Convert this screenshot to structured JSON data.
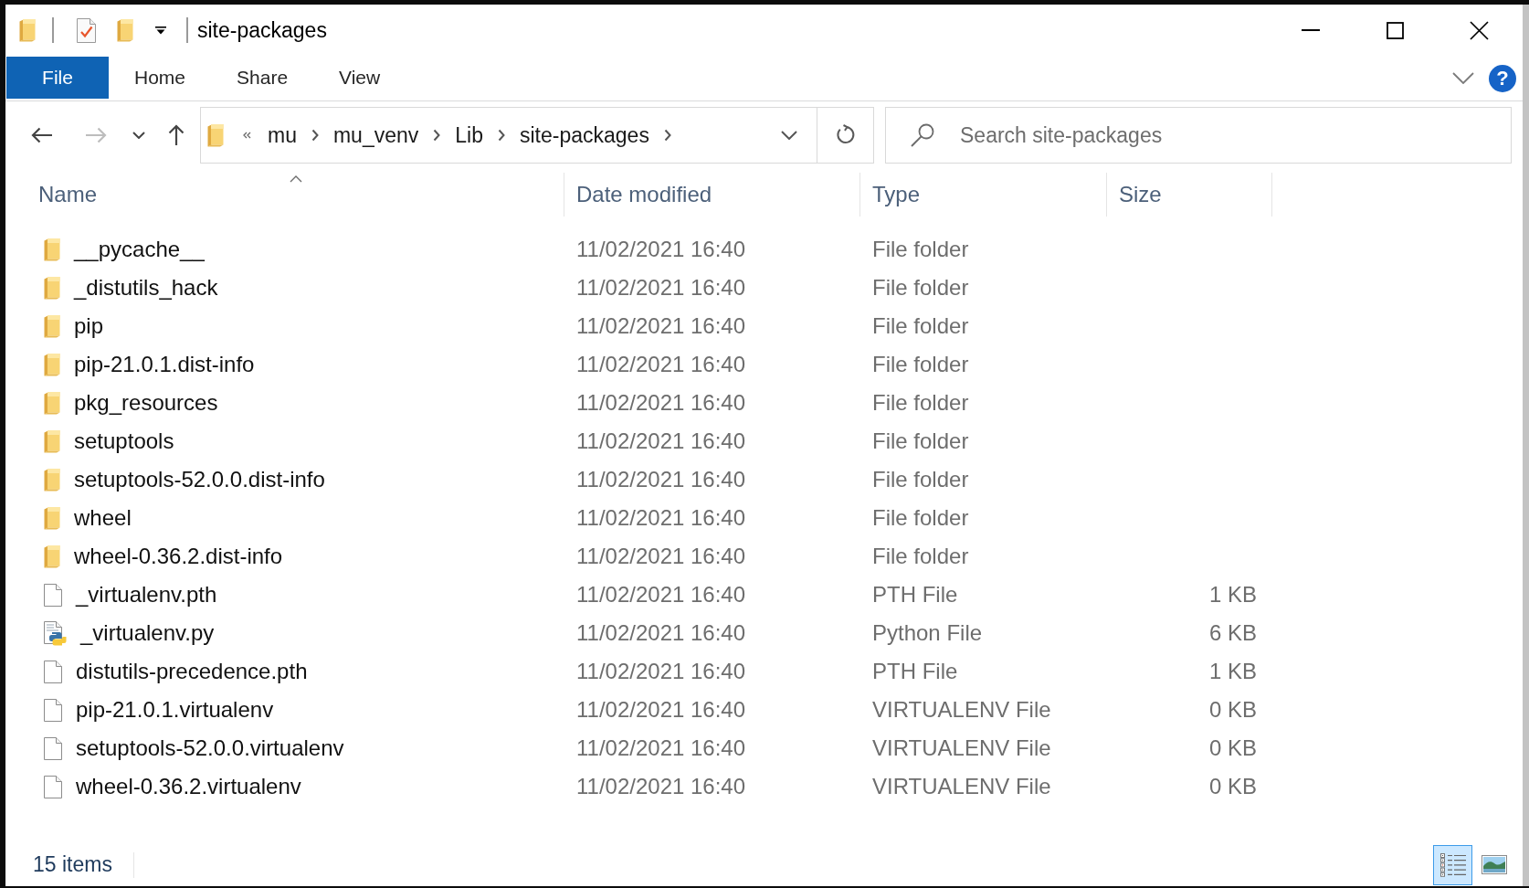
{
  "window": {
    "title": "site-packages"
  },
  "ribbon": {
    "file_tab": {
      "label": "File"
    },
    "tabs": [
      {
        "label": "Home",
        "selected": false
      },
      {
        "label": "Share",
        "selected": false
      },
      {
        "label": "View",
        "selected": false
      }
    ],
    "expanded": false,
    "help": {
      "label": "?"
    }
  },
  "navigation": [
    {
      "kind": "back",
      "disabled": false
    },
    {
      "kind": "forward",
      "disabled": true
    },
    {
      "kind": "recent",
      "disabled": false
    },
    {
      "kind": "up",
      "disabled": false
    }
  ],
  "address_bar": {
    "truncated": true,
    "crumbs": [
      "mu",
      "mu_venv",
      "Lib",
      "site-packages"
    ]
  },
  "search": {
    "placeholder": "Search site-packages"
  },
  "columns": [
    {
      "label": "Name",
      "sorted": true
    },
    {
      "label": "Date modified",
      "sorted": false
    },
    {
      "label": "Type",
      "sorted": false
    },
    {
      "label": "Size",
      "sorted": false
    }
  ],
  "rows": [
    {
      "kind": "folder",
      "name": "__pycache__",
      "date_modified": "11/02/2021 16:40",
      "type": "File folder",
      "selected": false
    },
    {
      "kind": "folder",
      "name": "_distutils_hack",
      "date_modified": "11/02/2021 16:40",
      "type": "File folder",
      "selected": false
    },
    {
      "kind": "folder",
      "name": "pip",
      "date_modified": "11/02/2021 16:40",
      "type": "File folder",
      "selected": false
    },
    {
      "kind": "folder",
      "name": "pip-21.0.1.dist-info",
      "date_modified": "11/02/2021 16:40",
      "type": "File folder",
      "selected": false
    },
    {
      "kind": "folder",
      "name": "pkg_resources",
      "date_modified": "11/02/2021 16:40",
      "type": "File folder",
      "selected": false
    },
    {
      "kind": "folder",
      "name": "setuptools",
      "date_modified": "11/02/2021 16:40",
      "type": "File folder",
      "selected": false
    },
    {
      "kind": "folder",
      "name": "setuptools-52.0.0.dist-info",
      "date_modified": "11/02/2021 16:40",
      "type": "File folder",
      "selected": false
    },
    {
      "kind": "folder",
      "name": "wheel",
      "date_modified": "11/02/2021 16:40",
      "type": "File folder",
      "selected": false
    },
    {
      "kind": "folder",
      "name": "wheel-0.36.2.dist-info",
      "date_modified": "11/02/2021 16:40",
      "type": "File folder",
      "selected": false
    },
    {
      "kind": "file",
      "name": "_virtualenv.pth",
      "date_modified": "11/02/2021 16:40",
      "type": "PTH File",
      "size": "1 KB",
      "selected": false
    },
    {
      "kind": "python",
      "name": "_virtualenv.py",
      "date_modified": "11/02/2021 16:40",
      "type": "Python File",
      "size": "6 KB",
      "selected": false
    },
    {
      "kind": "file",
      "name": "distutils-precedence.pth",
      "date_modified": "11/02/2021 16:40",
      "type": "PTH File",
      "size": "1 KB",
      "selected": false
    },
    {
      "kind": "file",
      "name": "pip-21.0.1.virtualenv",
      "date_modified": "11/02/2021 16:40",
      "type": "VIRTUALENV File",
      "size": "0 KB",
      "selected": false
    },
    {
      "kind": "file",
      "name": "setuptools-52.0.0.virtualenv",
      "date_modified": "11/02/2021 16:40",
      "type": "VIRTUALENV File",
      "size": "0 KB",
      "selected": false
    },
    {
      "kind": "file",
      "name": "wheel-0.36.2.virtualenv",
      "date_modified": "11/02/2021 16:40",
      "type": "VIRTUALENV File",
      "size": "0 KB",
      "selected": false
    }
  ],
  "status_bar": {
    "item_count": "15 items",
    "views": [
      {
        "kind": "details",
        "selected": true
      },
      {
        "kind": "large_icons",
        "selected": false
      }
    ]
  }
}
